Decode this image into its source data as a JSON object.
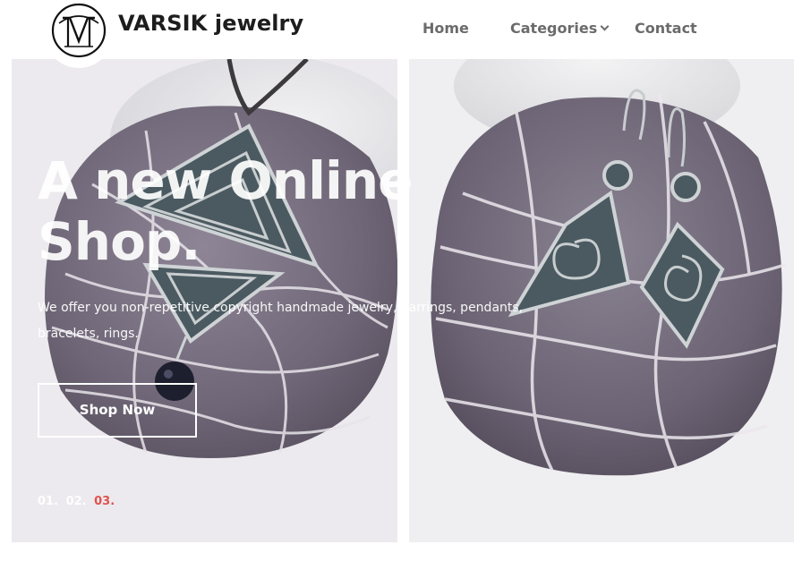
{
  "header": {
    "brand": "VARSIK jewelry",
    "logo_icon": "vm-monogram-logo",
    "nav": {
      "home": "Home",
      "categories": "Categories",
      "contact": "Contact"
    }
  },
  "hero": {
    "title_line1": "A new Online",
    "title_line2": "Shop.",
    "subtitle_line1": "We offer you non-repetitive copyright handmade jewelry, earrings, pendants,",
    "subtitle_line2": "bracelets, rings.",
    "button": "Shop Now",
    "pager": [
      "01.",
      "02.",
      "03."
    ],
    "active_slide": 3
  },
  "images": {
    "left": "pendant-on-stone-image",
    "right": "earrings-on-stone-image"
  },
  "colors": {
    "brand_text": "#1d1d1d",
    "nav_text": "#6b6b6b",
    "active_pager": "#e0524f"
  }
}
